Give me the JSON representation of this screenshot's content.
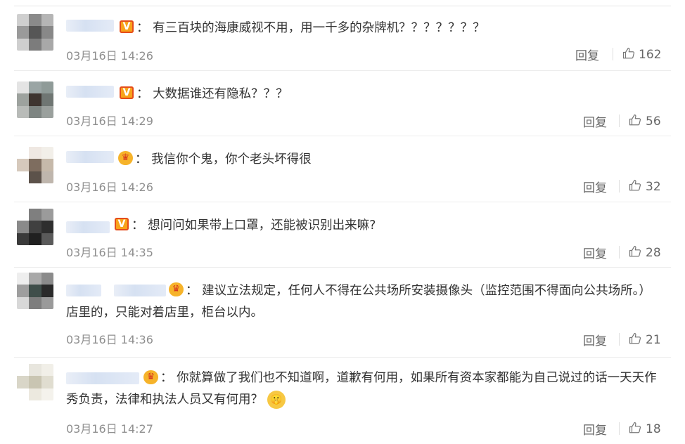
{
  "comments": [
    {
      "badge": "V",
      "text_lines": [
        "有三百块的海康威视不用，用一千多的杂牌机？？？？？？？"
      ],
      "timestamp": "03月16日 14:26",
      "reply_label": "回复",
      "likes": "162",
      "avatar_colors": [
        "#cfcfcf",
        "#8a8a8a",
        "#b5b5b5",
        "#9a9a9a",
        "#565656",
        "#888888",
        "#cfcfcf",
        "#7c7c7c",
        "#a8a8a8"
      ]
    },
    {
      "badge": "V",
      "text_lines": [
        "大数据谁还有隐私？？？"
      ],
      "timestamp": "03月16日 14:29",
      "reply_label": "回复",
      "likes": "56",
      "avatar_colors": [
        "#e4e4e4",
        "#9aa5a4",
        "#8f9b98",
        "#9da29e",
        "#3e3530",
        "#6f7673",
        "#b8bbb8",
        "#7e8582",
        "#9aa09d"
      ]
    },
    {
      "badge": "crown",
      "text_lines": [
        "我信你个鬼，你个老头坏得很"
      ],
      "timestamp": "03月16日 14:26",
      "reply_label": "回复",
      "likes": "32",
      "avatar_colors": [
        "#ffffff",
        "#efe8e2",
        "#f2efe9",
        "#d6c9bc",
        "#7e6d5f",
        "#c6b9aa",
        "#ffffff",
        "#5c524a",
        "#bfb6ad"
      ]
    },
    {
      "badge": "V",
      "text_lines": [
        "想问问如果带上口罩，还能被识别出来嘛?"
      ],
      "timestamp": "03月16日 14:35",
      "reply_label": "回复",
      "likes": "28",
      "avatar_colors": [
        "#ffffff",
        "#7f7f7f",
        "#9b9b9b",
        "#8a8a8a",
        "#404040",
        "#2e2e2e",
        "#3a3a3a",
        "#202020",
        "#5a5a5a"
      ]
    },
    {
      "badge": "crown",
      "text_lines": [
        "建议立法规定，任何人不得在公共场所安装摄像头（监控范围不得面向公共场所。）",
        "店里的，只能对着店里，柜台以内。"
      ],
      "timestamp": "03月16日 14:36",
      "reply_label": "回复",
      "likes": "21",
      "avatar_colors": [
        "#eeeeee",
        "#a9a9a9",
        "#8b8b8b",
        "#9e9e9e",
        "#3f4e4a",
        "#2a2a2a",
        "#d8d8d8",
        "#7e7e7e",
        "#9a9a9a"
      ]
    },
    {
      "badge": "crown",
      "text_lines": [
        "你就算做了我们也不知道啊，道歉有何用，如果所有资本家都能为自己说过的话一天天作",
        "秀负责，法律和执法人员又有何用？"
      ],
      "emoji": "🤫",
      "timestamp": "03月16日 14:27",
      "reply_label": "回复",
      "likes": "18",
      "avatar_colors": [
        "#ffffff",
        "#e8e6de",
        "#f1efe8",
        "#d9d6c8",
        "#c9c5b2",
        "#e0ddd0",
        "#ffffff",
        "#ece9df",
        "#f4f2ec"
      ]
    }
  ],
  "colors": {
    "text": "#333333",
    "meta": "#8f8f8f",
    "action": "#666666",
    "separator": "#ececec",
    "v_badge": "#f8a21a",
    "crown_badge": "#f6b32a"
  }
}
